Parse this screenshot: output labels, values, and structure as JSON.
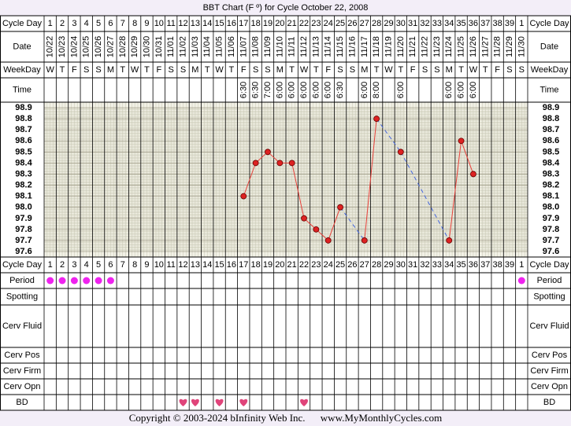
{
  "title": "BBT Chart (F º) for Cycle October 22, 2008",
  "row_labels": {
    "cycle_day": "Cycle Day",
    "date": "Date",
    "weekday": "WeekDay",
    "time": "Time",
    "period": "Period",
    "spotting": "Spotting",
    "cerv_fluid": "Cerv Fluid",
    "cerv_pos": "Cerv Pos",
    "cerv_firm": "Cerv Firm",
    "cerv_opn": "Cerv Opn",
    "bd": "BD"
  },
  "columns": {
    "cycle_days": [
      "1",
      "2",
      "3",
      "4",
      "5",
      "6",
      "7",
      "8",
      "9",
      "10",
      "11",
      "12",
      "13",
      "14",
      "15",
      "16",
      "17",
      "18",
      "19",
      "20",
      "21",
      "22",
      "23",
      "24",
      "25",
      "26",
      "27",
      "28",
      "29",
      "30",
      "31",
      "32",
      "33",
      "34",
      "35",
      "36",
      "37",
      "38",
      "39",
      "1"
    ],
    "dates": [
      "10/22",
      "10/23",
      "10/24",
      "10/25",
      "10/26",
      "10/27",
      "10/28",
      "10/29",
      "10/30",
      "10/31",
      "11/01",
      "11/02",
      "11/03",
      "11/04",
      "11/05",
      "11/06",
      "11/07",
      "11/08",
      "11/09",
      "11/10",
      "11/11",
      "11/12",
      "11/13",
      "11/14",
      "11/15",
      "11/16",
      "11/17",
      "11/18",
      "11/19",
      "11/20",
      "11/21",
      "11/22",
      "11/23",
      "11/24",
      "11/25",
      "11/26",
      "11/27",
      "11/28",
      "11/29",
      "11/30"
    ],
    "weekdays": [
      "W",
      "T",
      "F",
      "S",
      "S",
      "M",
      "T",
      "W",
      "T",
      "F",
      "S",
      "S",
      "M",
      "T",
      "W",
      "T",
      "F",
      "S",
      "S",
      "M",
      "T",
      "W",
      "T",
      "F",
      "S",
      "S",
      "M",
      "T",
      "W",
      "T",
      "F",
      "S",
      "S",
      "M",
      "T",
      "W",
      "T",
      "F",
      "S",
      "S"
    ],
    "times": [
      "",
      "",
      "",
      "",
      "",
      "",
      "",
      "",
      "",
      "",
      "",
      "",
      "",
      "",
      "",
      "",
      "6:30",
      "6:30",
      "7:00",
      "6:00",
      "6:00",
      "6:00",
      "6:00",
      "6:00",
      "6:30",
      "",
      "6:00",
      "8:00",
      "",
      "6:00",
      "",
      "",
      "",
      "6:00",
      "6:00",
      "6:00",
      "",
      "",
      "",
      ""
    ]
  },
  "chart_data": {
    "type": "line",
    "title": "BBT Chart (F º) for Cycle October 22, 2008",
    "ylim": [
      97.6,
      98.9
    ],
    "y_ticks": [
      "98.9",
      "98.8",
      "98.7",
      "98.6",
      "98.5",
      "98.4",
      "98.3",
      "98.2",
      "98.1",
      "98.0",
      "97.9",
      "97.8",
      "97.7",
      "97.6"
    ],
    "x": [
      "1",
      "2",
      "3",
      "4",
      "5",
      "6",
      "7",
      "8",
      "9",
      "10",
      "11",
      "12",
      "13",
      "14",
      "15",
      "16",
      "17",
      "18",
      "19",
      "20",
      "21",
      "22",
      "23",
      "24",
      "25",
      "26",
      "27",
      "28",
      "29",
      "30",
      "31",
      "32",
      "33",
      "34",
      "35",
      "36",
      "37",
      "38",
      "39",
      "1"
    ],
    "temps": [
      null,
      null,
      null,
      null,
      null,
      null,
      null,
      null,
      null,
      null,
      null,
      null,
      null,
      null,
      null,
      null,
      98.1,
      98.4,
      98.5,
      98.4,
      98.4,
      97.9,
      97.8,
      97.7,
      98.0,
      null,
      97.7,
      98.8,
      null,
      98.5,
      null,
      null,
      null,
      97.7,
      98.6,
      98.3,
      null,
      null,
      null,
      null
    ],
    "line_color": "#e8413a",
    "gap_color": "#4466dd",
    "point_color": "#dd2222",
    "grid": true
  },
  "period_days": [
    0,
    1,
    2,
    3,
    4,
    5,
    39
  ],
  "bd_days": [
    11,
    12,
    14,
    16,
    21
  ],
  "colors": {
    "background": "#f3eef8",
    "plot_bg": "#f2f1e6",
    "grid": "#c8c8b4",
    "border": "#000000",
    "period_dot": "#ee22ee",
    "heart": "#e0447a",
    "white": "#ffffff"
  },
  "footer": {
    "copyright": "Copyright © 2003-2024 bInfinity Web Inc.",
    "site": "www.MyMonthlyCycles.com"
  }
}
